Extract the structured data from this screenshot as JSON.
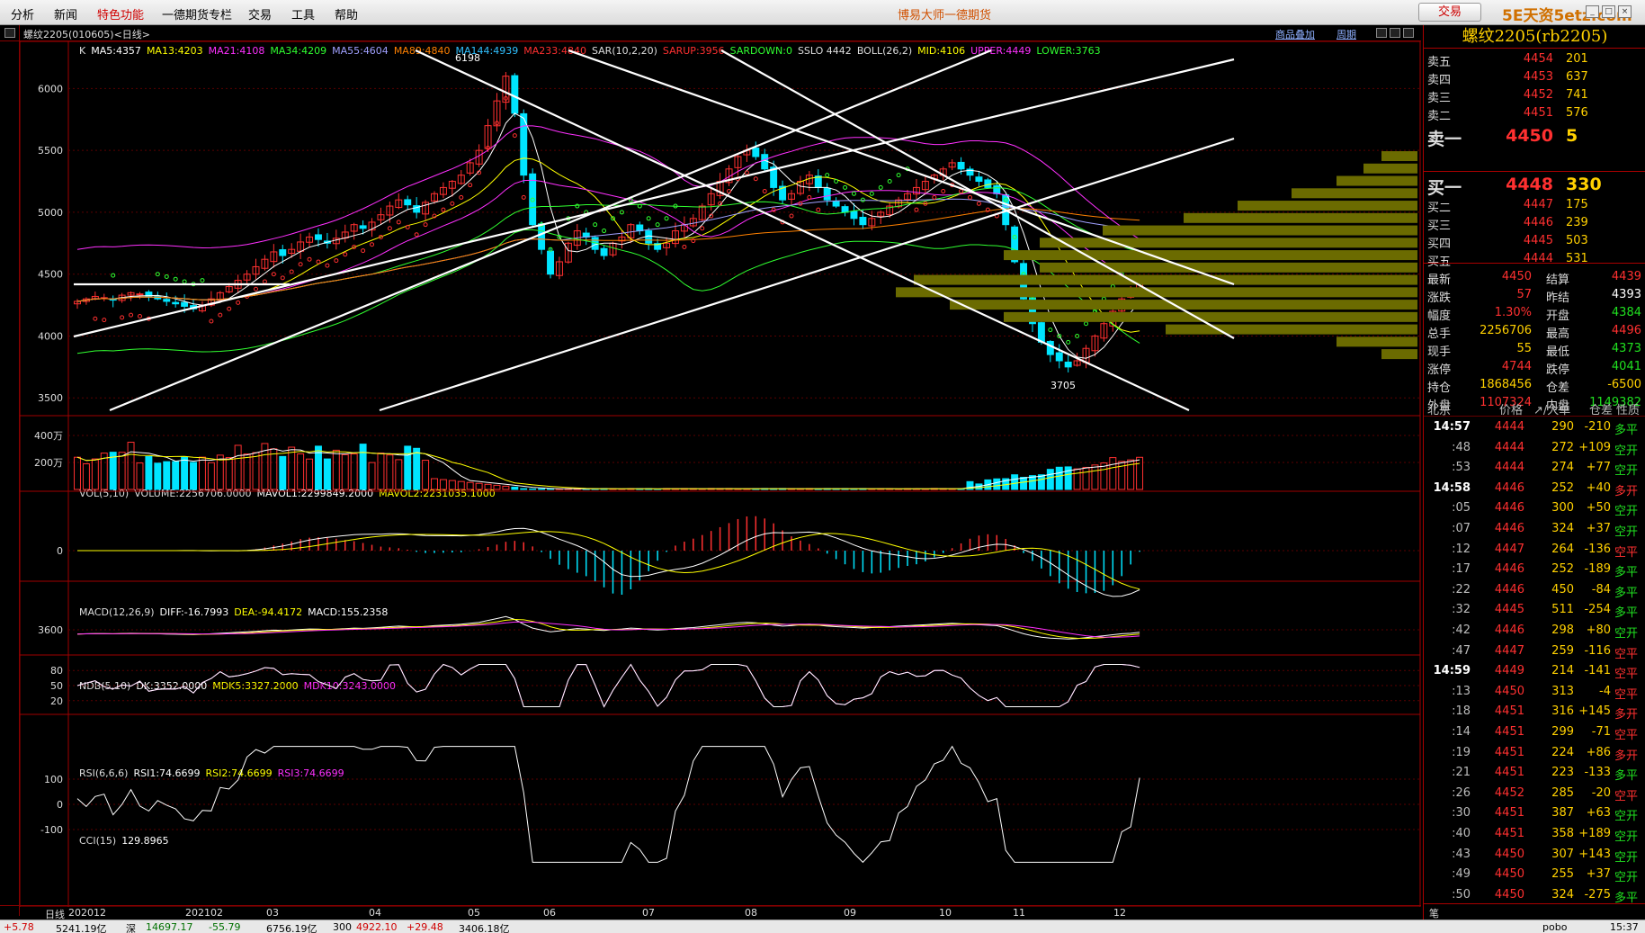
{
  "menu": [
    "分析",
    "新闻",
    "特色功能",
    "一德期货专栏",
    "交易",
    "工具",
    "帮助"
  ],
  "app_title": "博易大师一德期货",
  "trade_button": "交易",
  "watermark": "5E天资5etz.com",
  "contract_label": "螺纹2205(010605)<日线>",
  "top_links": [
    "商品叠加",
    "周期"
  ],
  "legends": {
    "main": [
      {
        "t": "K",
        "c": "#dddddd"
      },
      {
        "t": "MA5:4357",
        "c": "#ffffff"
      },
      {
        "t": "MA13:4203",
        "c": "#ffff00"
      },
      {
        "t": "MA21:4108",
        "c": "#ff30ff"
      },
      {
        "t": "MA34:4209",
        "c": "#30ff30"
      },
      {
        "t": "MA55:4604",
        "c": "#a0a0ff"
      },
      {
        "t": "MA89:4840",
        "c": "#ff8000"
      },
      {
        "t": "MA144:4939",
        "c": "#30c0ff"
      },
      {
        "t": "MA233:4840",
        "c": "#ff3030"
      },
      {
        "t": "SAR(10,2,20)",
        "c": "#dddddd"
      },
      {
        "t": "SARUP:3956",
        "c": "#ff3030"
      },
      {
        "t": "SARDOWN:0",
        "c": "#30ff30"
      },
      {
        "t": "SSLO 4442",
        "c": "#dddddd"
      },
      {
        "t": "BOLL(26,2)",
        "c": "#dddddd"
      },
      {
        "t": "MID:4106",
        "c": "#ffff00"
      },
      {
        "t": "UPPER:4449",
        "c": "#ff30ff"
      },
      {
        "t": "LOWER:3763",
        "c": "#30ff30"
      }
    ],
    "vol": [
      {
        "t": "VOL(5,10)",
        "c": "#dddddd"
      },
      {
        "t": "VOLUME:2256706.0000",
        "c": "#dddddd"
      },
      {
        "t": "MAVOL1:2299849.2000",
        "c": "#ffffff"
      },
      {
        "t": "MAVOL2:2231035.1000",
        "c": "#ffff00"
      }
    ],
    "macd": [
      {
        "t": "MACD(12,26,9)",
        "c": "#dddddd"
      },
      {
        "t": "DIFF:-16.7993",
        "c": "#ffffff"
      },
      {
        "t": "DEA:-94.4172",
        "c": "#ffff00"
      },
      {
        "t": "MACD:155.2358",
        "c": "#ffffff"
      }
    ],
    "ndb": [
      {
        "t": "NDB(5,10)",
        "c": "#dddddd"
      },
      {
        "t": "DK:3352.0000",
        "c": "#ffffff"
      },
      {
        "t": "MDK5:3327.2000",
        "c": "#ffff00"
      },
      {
        "t": "MDK10:3243.0000",
        "c": "#ff30ff"
      }
    ],
    "rsi": [
      {
        "t": "RSI(6,6,6)",
        "c": "#dddddd"
      },
      {
        "t": "RSI1:74.6699",
        "c": "#ffffff"
      },
      {
        "t": "RSI2:74.6699",
        "c": "#ffff00"
      },
      {
        "t": "RSI3:74.6699",
        "c": "#ff30ff"
      }
    ],
    "cci": [
      {
        "t": "CCI(15)",
        "c": "#dddddd"
      },
      {
        "t": "129.8965",
        "c": "#ffffff"
      }
    ]
  },
  "axis_labels": {
    "price": [
      "6000",
      "5500",
      "5000",
      "4500",
      "4000",
      "3500"
    ],
    "vol": [
      "400万",
      "200万"
    ],
    "macd": [
      "0"
    ],
    "ndb": [
      "3600"
    ],
    "rsi": [
      "80",
      "50",
      "20"
    ],
    "cci": [
      "100",
      "0",
      "-100"
    ]
  },
  "marks": {
    "high": "6198",
    "low": "3705"
  },
  "date_axis": [
    "日线",
    "202012",
    "202102",
    "03",
    "04",
    "05",
    "06",
    "07",
    "08",
    "09",
    "10",
    "11",
    "12"
  ],
  "colors": {
    "up": "#ff3030",
    "down": "#00e5ff",
    "trendline": "#ffffff",
    "volume_profile": "#6b6b00"
  },
  "panel": {
    "title": "螺纹2205(rb2205)",
    "asks": [
      {
        "label": "卖五",
        "price": "4454",
        "vol": "201"
      },
      {
        "label": "卖四",
        "price": "4453",
        "vol": "637"
      },
      {
        "label": "卖三",
        "price": "4452",
        "vol": "741"
      },
      {
        "label": "卖二",
        "price": "4451",
        "vol": "576"
      },
      {
        "label": "卖一",
        "price": "4450",
        "vol": "5"
      }
    ],
    "bids": [
      {
        "label": "买一",
        "price": "4448",
        "vol": "330"
      },
      {
        "label": "买二",
        "price": "4447",
        "vol": "175"
      },
      {
        "label": "买三",
        "price": "4446",
        "vol": "239"
      },
      {
        "label": "买四",
        "price": "4445",
        "vol": "503"
      },
      {
        "label": "买五",
        "price": "4444",
        "vol": "531"
      }
    ],
    "stats": [
      {
        "l1": "最新",
        "v1": "4450",
        "c1": "red",
        "l2": "结算",
        "v2": "4439",
        "c2": "red"
      },
      {
        "l1": "涨跌",
        "v1": "57",
        "c1": "red",
        "l2": "昨结",
        "v2": "4393",
        "c2": "white"
      },
      {
        "l1": "幅度",
        "v1": "1.30%",
        "c1": "red",
        "l2": "开盘",
        "v2": "4384",
        "c2": "green"
      },
      {
        "l1": "总手",
        "v1": "2256706",
        "c1": "yellow",
        "l2": "最高",
        "v2": "4496",
        "c2": "red"
      },
      {
        "l1": "现手",
        "v1": "55",
        "c1": "yellow",
        "l2": "最低",
        "v2": "4373",
        "c2": "green"
      },
      {
        "l1": "涨停",
        "v1": "4744",
        "c1": "red",
        "l2": "跌停",
        "v2": "4041",
        "c2": "green"
      },
      {
        "l1": "持仓",
        "v1": "1868456",
        "c1": "yellow",
        "l2": "仓差",
        "v2": "-6500",
        "c2": "yellow"
      },
      {
        "l1": "外盘",
        "v1": "1107324",
        "c1": "red",
        "l2": "内盘",
        "v2": "1149382",
        "c2": "green"
      }
    ],
    "tick_header": [
      "北京",
      "价格",
      "↗/大单",
      "仓差",
      "性质"
    ],
    "ticks": [
      {
        "t": "14:57",
        "p": "4444",
        "v": "290",
        "o": "-210",
        "oc": "yellow",
        "n": "多平",
        "nc": "green",
        "big": true
      },
      {
        "t": ":48",
        "p": "4444",
        "v": "272",
        "o": "+109",
        "oc": "yellow",
        "n": "空开",
        "nc": "green"
      },
      {
        "t": ":53",
        "p": "4444",
        "v": "274",
        "o": "+77",
        "oc": "yellow",
        "n": "空开",
        "nc": "green"
      },
      {
        "t": "14:58",
        "p": "4446",
        "v": "252",
        "o": "+40",
        "oc": "yellow",
        "n": "多开",
        "nc": "red",
        "big": true
      },
      {
        "t": ":05",
        "p": "4446",
        "v": "300",
        "o": "+50",
        "oc": "yellow",
        "n": "空开",
        "nc": "green"
      },
      {
        "t": ":07",
        "p": "4446",
        "v": "324",
        "o": "+37",
        "oc": "yellow",
        "n": "空开",
        "nc": "green"
      },
      {
        "t": ":12",
        "p": "4447",
        "v": "264",
        "o": "-136",
        "oc": "yellow",
        "n": "空平",
        "nc": "red"
      },
      {
        "t": ":17",
        "p": "4446",
        "v": "252",
        "o": "-189",
        "oc": "yellow",
        "n": "多平",
        "nc": "green"
      },
      {
        "t": ":22",
        "p": "4446",
        "v": "450",
        "o": "-84",
        "oc": "yellow",
        "n": "多平",
        "nc": "green"
      },
      {
        "t": ":32",
        "p": "4445",
        "v": "511",
        "o": "-254",
        "oc": "yellow",
        "n": "多平",
        "nc": "green"
      },
      {
        "t": ":42",
        "p": "4446",
        "v": "298",
        "o": "+80",
        "oc": "yellow",
        "n": "空开",
        "nc": "green"
      },
      {
        "t": ":47",
        "p": "4447",
        "v": "259",
        "o": "-116",
        "oc": "yellow",
        "n": "空平",
        "nc": "red"
      },
      {
        "t": "14:59",
        "p": "4449",
        "v": "214",
        "o": "-141",
        "oc": "yellow",
        "n": "空平",
        "nc": "red",
        "big": true
      },
      {
        "t": ":13",
        "p": "4450",
        "v": "313",
        "o": "-4",
        "oc": "yellow",
        "n": "空平",
        "nc": "red"
      },
      {
        "t": ":18",
        "p": "4451",
        "v": "316",
        "o": "+145",
        "oc": "yellow",
        "n": "多开",
        "nc": "red"
      },
      {
        "t": ":14",
        "p": "4451",
        "v": "299",
        "o": "-71",
        "oc": "yellow",
        "n": "空平",
        "nc": "red"
      },
      {
        "t": ":19",
        "p": "4451",
        "v": "224",
        "o": "+86",
        "oc": "yellow",
        "n": "多开",
        "nc": "red"
      },
      {
        "t": ":21",
        "p": "4451",
        "v": "223",
        "o": "-133",
        "oc": "yellow",
        "n": "多平",
        "nc": "green"
      },
      {
        "t": ":26",
        "p": "4452",
        "v": "285",
        "o": "-20",
        "oc": "yellow",
        "n": "空平",
        "nc": "red"
      },
      {
        "t": ":30",
        "p": "4451",
        "v": "387",
        "o": "+63",
        "oc": "yellow",
        "n": "空开",
        "nc": "green"
      },
      {
        "t": ":40",
        "p": "4451",
        "v": "358",
        "o": "+189",
        "oc": "yellow",
        "n": "空开",
        "nc": "green"
      },
      {
        "t": ":43",
        "p": "4450",
        "v": "307",
        "o": "+143",
        "oc": "yellow",
        "n": "空开",
        "nc": "green"
      },
      {
        "t": ":49",
        "p": "4450",
        "v": "255",
        "o": "+37",
        "oc": "yellow",
        "n": "空开",
        "nc": "green"
      },
      {
        "t": ":50",
        "p": "4450",
        "v": "324",
        "o": "-275",
        "oc": "yellow",
        "n": "多平",
        "nc": "green"
      }
    ],
    "bottom_label": "笔"
  },
  "status": [
    {
      "t": "+5.78",
      "c": "#d00000"
    },
    {
      "t": "5241.19亿",
      "c": "#000000"
    },
    {
      "t": "深",
      "c": "#000000"
    },
    {
      "t": "14697.17",
      "c": "#007000"
    },
    {
      "t": "-55.79",
      "c": "#007000"
    },
    {
      "t": "6756.19亿",
      "c": "#000000"
    },
    {
      "t": "300",
      "c": "#000000"
    },
    {
      "t": "4922.10",
      "c": "#d00000"
    },
    {
      "t": "+29.48",
      "c": "#d00000"
    },
    {
      "t": "3406.18亿",
      "c": "#000000"
    },
    {
      "t": "pobo",
      "c": "#000000"
    },
    {
      "t": "15:37",
      "c": "#000000"
    }
  ],
  "chart_data": {
    "type": "candlestick",
    "price_range": [
      3400,
      6250
    ],
    "closes": [
      4280,
      4300,
      4320,
      4310,
      4290,
      4330,
      4350,
      4340,
      4320,
      4300,
      4280,
      4260,
      4240,
      4220,
      4250,
      4300,
      4350,
      4400,
      4450,
      4500,
      4560,
      4620,
      4680,
      4650,
      4700,
      4760,
      4800,
      4780,
      4750,
      4790,
      4840,
      4900,
      4870,
      4920,
      4980,
      5050,
      5100,
      5060,
      5000,
      5080,
      5150,
      5200,
      5250,
      5300,
      5400,
      5500,
      5700,
      5900,
      6100,
      5800,
      5300,
      4900,
      4700,
      4500,
      4600,
      4750,
      4850,
      4800,
      4700,
      4650,
      4750,
      4800,
      4900,
      4850,
      4750,
      4700,
      4750,
      4850,
      4900,
      4950,
      5050,
      5150,
      5250,
      5350,
      5450,
      5500,
      5450,
      5350,
      5200,
      5100,
      5150,
      5250,
      5300,
      5200,
      5100,
      5050,
      5000,
      4950,
      4900,
      4950,
      5000,
      5050,
      5100,
      5150,
      5200,
      5250,
      5300,
      5350,
      5400,
      5350,
      5300,
      5250,
      5200,
      5150,
      4900,
      4600,
      4300,
      4100,
      3950,
      3850,
      3800,
      3750,
      3800,
      3900,
      4000,
      4100,
      4200,
      4300,
      4350,
      4450
    ],
    "volume_max": 4000000
  }
}
